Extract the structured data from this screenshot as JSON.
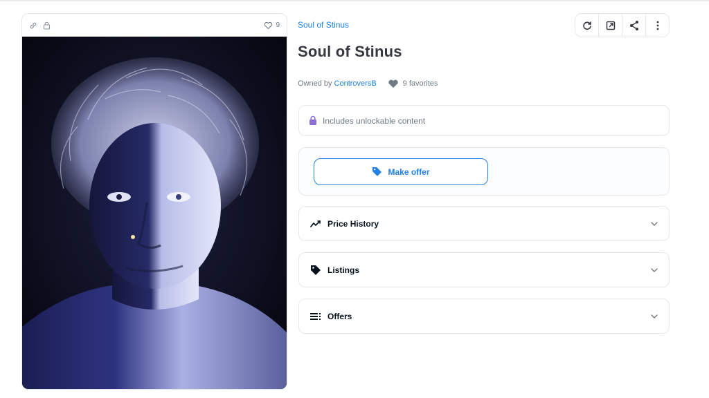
{
  "media": {
    "favorite_count": "9",
    "icons": [
      "link-icon",
      "lock-icon",
      "heart-outline-icon"
    ]
  },
  "item": {
    "collection": "Soul of Stinus",
    "title": "Soul of Stinus",
    "owner_prefix": "Owned by",
    "owner_name": "ControversB",
    "favorites": "9 favorites"
  },
  "actions": [
    {
      "name": "refresh-icon"
    },
    {
      "name": "external-link-icon"
    },
    {
      "name": "share-icon"
    },
    {
      "name": "more-icon"
    }
  ],
  "unlockable": {
    "label": "Includes unlockable content"
  },
  "offer": {
    "button_label": "Make offer"
  },
  "sections": {
    "price_history": "Price History",
    "listings": "Listings",
    "offers": "Offers"
  },
  "colors": {
    "accent": "#2081e2",
    "unlock_purple": "#8b6fd6",
    "border": "#e5e8eb",
    "muted_text": "#707a83"
  }
}
